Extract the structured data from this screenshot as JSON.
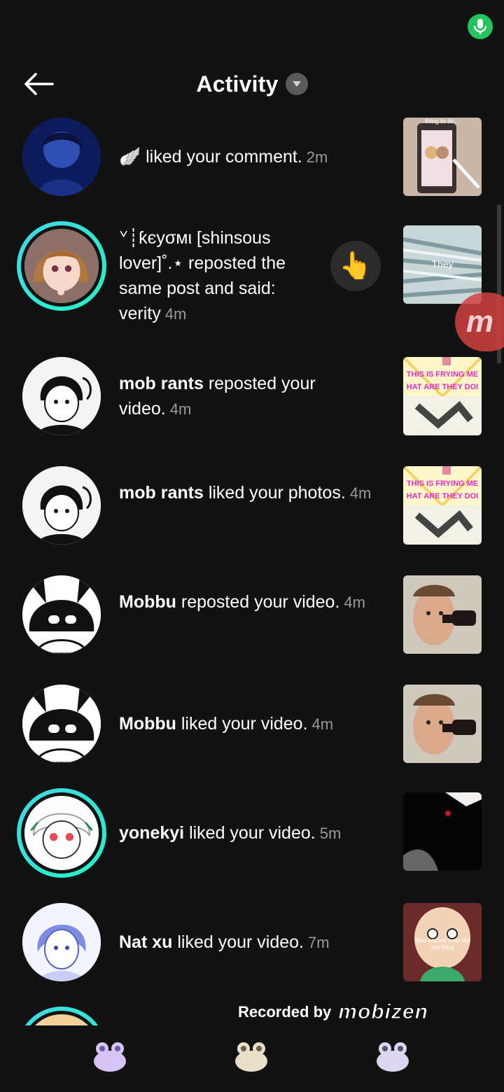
{
  "header": {
    "title": "Activity"
  },
  "activities": [
    {
      "user": "",
      "prefix": "🪽",
      "action": "liked your comment.",
      "time": "2m"
    },
    {
      "user": "",
      "prefix": "ᘁ┊ƙєуσмι [shinsous lover]˚.⋆",
      "action": "reposted the same post and said: verity",
      "time": "4m"
    },
    {
      "user": "mob rants",
      "prefix": "",
      "action": "reposted your video.",
      "time": "4m"
    },
    {
      "user": "mob rants",
      "prefix": "",
      "action": "liked your photos.",
      "time": "4m"
    },
    {
      "user": "Mobbu",
      "prefix": "",
      "action": "reposted your video.",
      "time": "4m"
    },
    {
      "user": "Mobbu",
      "prefix": "",
      "action": "liked your video.",
      "time": "4m"
    },
    {
      "user": "yonekyi",
      "prefix": "",
      "action": "liked your video.",
      "time": "5m"
    },
    {
      "user": "Nat xu",
      "prefix": "",
      "action": "liked your video.",
      "time": "7m"
    }
  ],
  "thumbs": {
    "t1_caption": "thing to do...",
    "t2_caption": "They",
    "t3_caption_1": "THIS IS FRYING ME",
    "t3_caption_2": "HAT ARE THEY DOI",
    "t8_caption_1": "does anyone even like",
    "t8_caption_2": "this thing"
  },
  "reaction_icon": "pointing-hand-icon",
  "watermark": {
    "recorded_by": "Recorded by",
    "brand": "mobizen"
  },
  "overlay_bubble": {
    "letter": "m"
  },
  "colors": {
    "background": "#121212",
    "story_ring": "#3fd8e6",
    "mic": "#22c55e",
    "time": "#9a9a9a"
  }
}
